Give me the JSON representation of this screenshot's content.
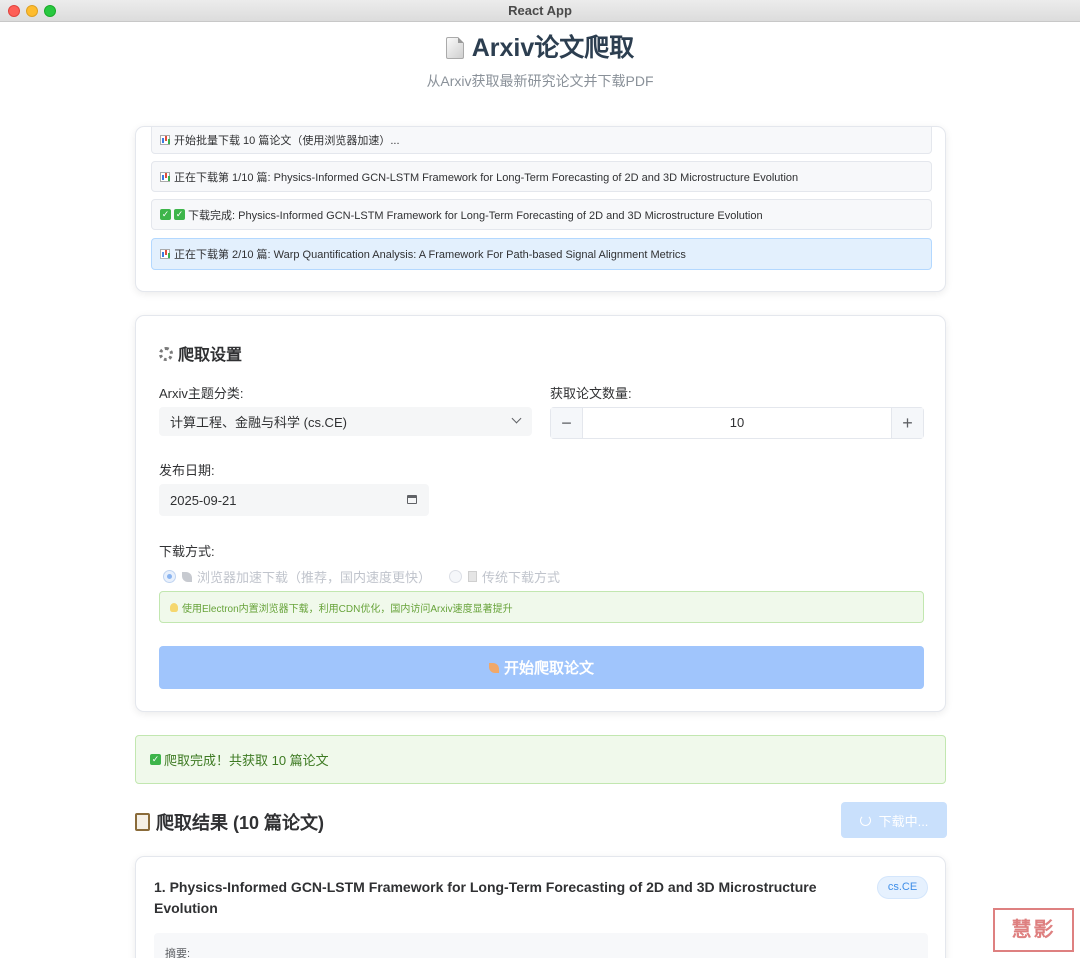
{
  "window": {
    "title": "React App"
  },
  "header": {
    "title": "Arxiv论文爬取",
    "subtitle": "从Arxiv获取最新研究论文并下载PDF",
    "icon": "document-icon"
  },
  "log": {
    "items": [
      {
        "icon": "chart-icon",
        "text": "开始批量下载 10 篇论文（使用浏览器加速）..."
      },
      {
        "icon": "chart-icon",
        "text": "正在下载第 1/10 篇: Physics-Informed GCN-LSTM Framework for Long-Term Forecasting of 2D and 3D Microstructure Evolution"
      },
      {
        "icon": "check-icon",
        "text": "下载完成: Physics-Informed GCN-LSTM Framework for Long-Term Forecasting of 2D and 3D Microstructure Evolution"
      },
      {
        "icon": "chart-icon",
        "text": "正在下载第 2/10 篇: Warp Quantification Analysis: A Framework For Path-based Signal Alignment Metrics"
      }
    ]
  },
  "settings": {
    "title": "爬取设置",
    "category_label": "Arxiv主题分类:",
    "category_value": "计算工程、金融与科学 (cs.CE)",
    "count_label": "获取论文数量:",
    "count_value": "10",
    "minus": "−",
    "plus": "+",
    "date_label": "发布日期:",
    "date_value": "2025-09-21",
    "method_label": "下载方式:",
    "method_browser": "浏览器加速下载（推荐，国内速度更快）",
    "method_traditional": "传统下载方式",
    "method_selected": "browser",
    "tip": "使用Electron内置浏览器下载，利用CDN优化，国内访问Arxiv速度显著提升",
    "start_button": "开始爬取论文"
  },
  "status": {
    "success": "爬取完成！共获取 10 篇论文"
  },
  "results": {
    "title": "爬取结果 (10 篇论文)",
    "download_button": "下载中...",
    "papers": [
      {
        "title": "1. Physics-Informed GCN-LSTM Framework for Long-Term Forecasting of 2D and 3D Microstructure Evolution",
        "tag": "cs.CE",
        "abstract_label": "摘要:"
      }
    ]
  },
  "watermark": "慧影"
}
